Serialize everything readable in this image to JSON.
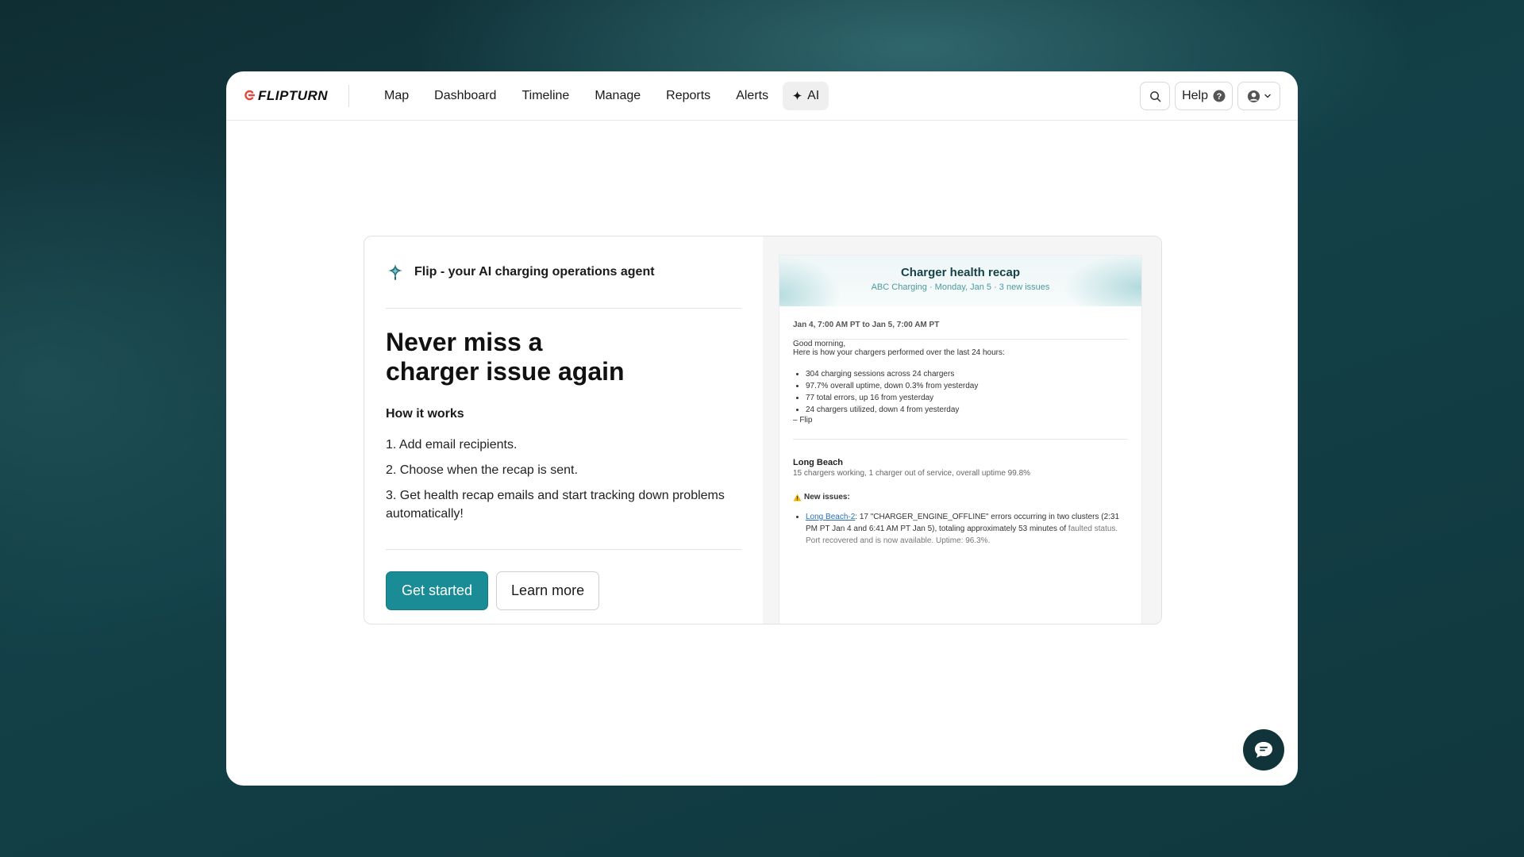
{
  "brand": {
    "name": "FLIPTURN"
  },
  "nav": {
    "items": [
      {
        "label": "Map"
      },
      {
        "label": "Dashboard"
      },
      {
        "label": "Timeline"
      },
      {
        "label": "Manage"
      },
      {
        "label": "Reports"
      },
      {
        "label": "Alerts"
      }
    ],
    "active": {
      "label": "AI",
      "icon": "sparkle-icon"
    }
  },
  "toolbar": {
    "search_icon": "search-icon",
    "help_label": "Help",
    "help_icon": "question-circle-icon",
    "user_icon": "user-circle-icon"
  },
  "promo": {
    "agent_label": "Flip - your AI charging operations agent",
    "headline_line1": "Never miss a",
    "headline_line2": "charger issue again",
    "how_title": "How it works",
    "steps": [
      "1. Add email recipients.",
      "2. Choose when the recap is sent.",
      "3. Get health recap emails and start tracking down problems automatically!"
    ],
    "primary_cta": "Get started",
    "secondary_cta": "Learn more"
  },
  "email": {
    "title": "Charger health recap",
    "subtitle": "ABC Charging · Monday, Jan 5 · 3 new issues",
    "period": "Jan 4, 7:00 AM PT to Jan 5, 7:00 AM PT",
    "greeting": "Good morning,",
    "intro": "Here is how your chargers performed over the last 24 hours:",
    "bullets": [
      "304 charging sessions across 24 chargers",
      "97.7% overall uptime, down 0.3% from yesterday",
      "77 total errors, up 16 from yesterday",
      "24 chargers utilized, down 4 from yesterday"
    ],
    "signature": "– Flip",
    "location": {
      "name": "Long Beach",
      "summary": "15 chargers working, 1 charger out of service, overall uptime 99.8%",
      "new_issues_label": "New issues:",
      "issue_link": "Long Beach-2",
      "issue_text": ": 17 \"CHARGER_ENGINE_OFFLINE\" errors occurring in two clusters (2:31 PM PT Jan 4 and 6:41 AM PT Jan 5), totaling approximately 53 minutes of",
      "issue_text_faded": "faulted status. Port recovered and is now available. Uptime: 96.3%."
    }
  },
  "colors": {
    "accent": "#1a8c95",
    "brand_mark": "#e2483d",
    "fab": "#11343a"
  }
}
